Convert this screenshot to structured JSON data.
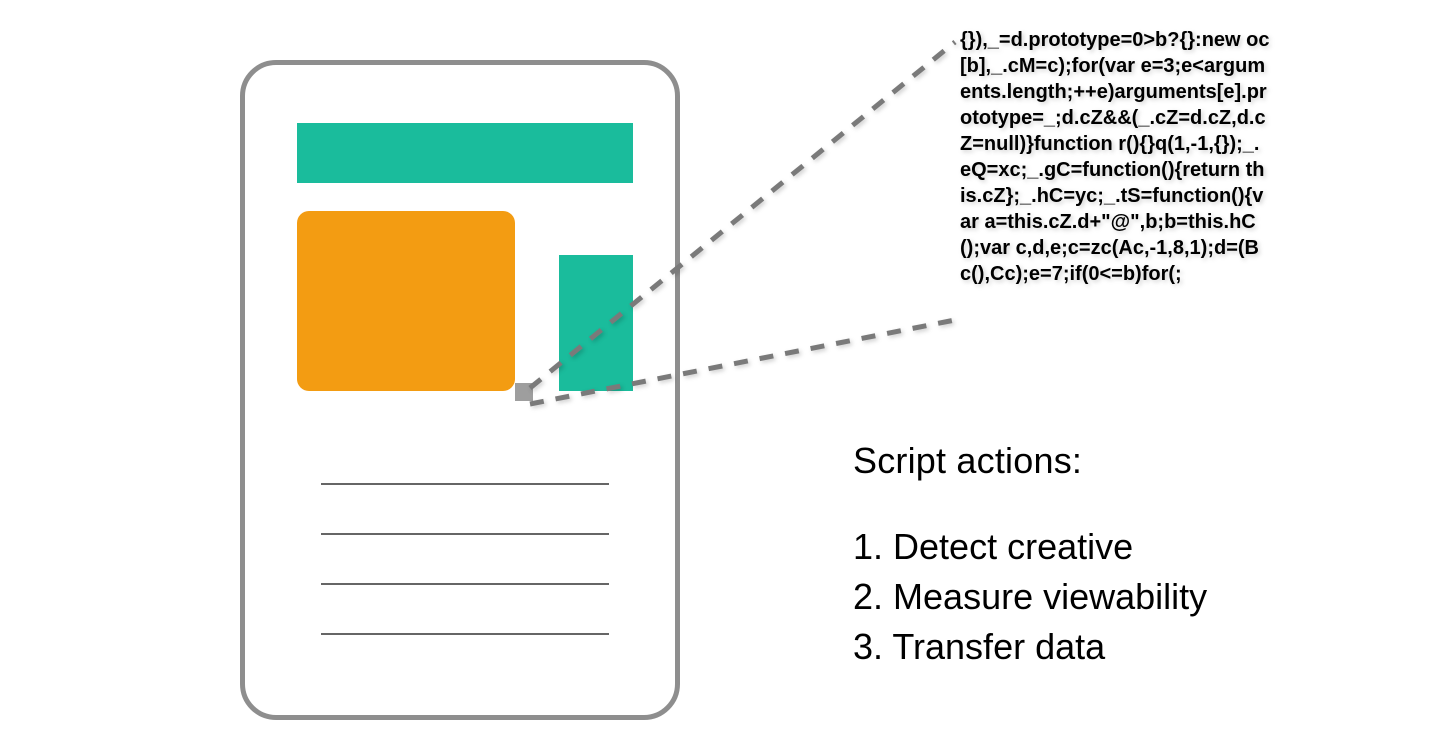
{
  "code_block": "{}),_=d.prototype=0>b?{}:new oc[b],_.cM=c);for(var e=3;e<arguments.length;++e)arguments[e].prototype=_;d.cZ&&(_.cZ=d.cZ,d.cZ=null)}function r(){}q(1,-1,{});_.eQ=xc;_.gC=function(){return this.cZ};_.hC=yc;_.tS=function(){var a=this.cZ.d+\"@\",b;b=this.hC();var c,d,e;c=zc(Ac,-1,8,1);d=(Bc(),Cc);e=7;if(0<=b)for(;",
  "actions": {
    "heading": "Script actions:",
    "items": [
      "Detect creative",
      "Measure viewability",
      "Transfer data"
    ]
  }
}
